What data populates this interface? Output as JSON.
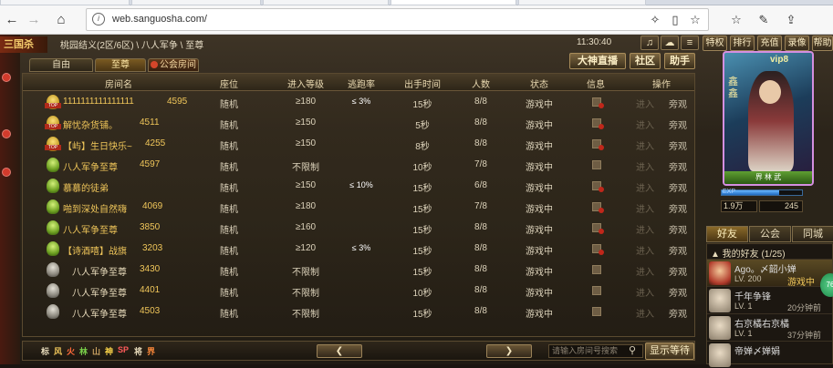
{
  "browser": {
    "url": "web.sanguosha.com/",
    "back_icon": "←",
    "forward_icon": "→",
    "refresh_icon": "⟳",
    "home_icon": "⌂",
    "info_icon": "i",
    "extension_icon": "✧",
    "reading_icon": "▯",
    "favorite_icon": "☆",
    "favorites_list_icon": "☆",
    "notes_icon": "✎",
    "share_icon": "⇪"
  },
  "game": {
    "logo": "三国杀",
    "breadcrumb": "桃园结义(2区/6区) \\ 八人军争 \\ 至尊",
    "clock": "11:30:40",
    "top_icons": [
      "♫",
      "☁",
      "≡"
    ],
    "top_buttons": [
      "特权",
      "排行",
      "充值",
      "录像",
      "帮助"
    ],
    "room_tabs": [
      "自由",
      "至尊",
      "公会房间"
    ],
    "right_buttons": [
      "大神直播",
      "社区",
      "助手"
    ],
    "columns": [
      "房间名",
      "座位",
      "进入等级",
      "逃跑率",
      "出手时间",
      "人数",
      "状态",
      "信息",
      "操作"
    ],
    "rows": [
      {
        "level": "top",
        "name": "1111111111111111",
        "id": "4595",
        "seat": "随机",
        "min_level": "≥180",
        "escape": "≤ 3%",
        "time": "15秒",
        "count": "8/8",
        "status": "游戏中",
        "lock": "red",
        "enter": "进入",
        "watch": "旁观"
      },
      {
        "level": "top",
        "name": "解忧杂货铺。",
        "id": "4511",
        "seat": "随机",
        "min_level": "≥150",
        "escape": "",
        "time": "5秒",
        "count": "8/8",
        "status": "游戏中",
        "lock": "red",
        "enter": "进入",
        "watch": "旁观"
      },
      {
        "level": "top",
        "name": "【屿】生日快乐~",
        "id": "4255",
        "seat": "随机",
        "min_level": "≥150",
        "escape": "",
        "time": "8秒",
        "count": "8/8",
        "status": "游戏中",
        "lock": "red",
        "enter": "进入",
        "watch": "旁观"
      },
      {
        "level": "green",
        "name": "八人军争至尊",
        "id": "4597",
        "seat": "随机",
        "min_level": "不限制",
        "escape": "",
        "time": "10秒",
        "count": "7/8",
        "status": "游戏中",
        "lock": "plain",
        "enter": "进入",
        "watch": "旁观"
      },
      {
        "level": "green",
        "name": "慕慕的徒弟",
        "id": "",
        "seat": "随机",
        "min_level": "≥150",
        "escape": "≤ 10%",
        "time": "15秒",
        "count": "6/8",
        "status": "游戏中",
        "lock": "red",
        "enter": "进入",
        "watch": "旁观"
      },
      {
        "level": "green",
        "name": "啪到深处自然嗨",
        "id": "4069",
        "seat": "随机",
        "min_level": "≥180",
        "escape": "",
        "time": "15秒",
        "count": "7/8",
        "status": "游戏中",
        "lock": "red",
        "enter": "进入",
        "watch": "旁观"
      },
      {
        "level": "green",
        "name": "八人军争至尊",
        "id": "3850",
        "seat": "随机",
        "min_level": "≥160",
        "escape": "",
        "time": "15秒",
        "count": "8/8",
        "status": "游戏中",
        "lock": "red",
        "enter": "进入",
        "watch": "旁观"
      },
      {
        "level": "green",
        "name": "【诗酒嘻】战旗",
        "id": "3203",
        "seat": "随机",
        "min_level": "≥120",
        "escape": "≤ 3%",
        "time": "15秒",
        "count": "8/8",
        "status": "游戏中",
        "lock": "red",
        "enter": "进入",
        "watch": "旁观"
      },
      {
        "level": "grey",
        "name": "八人军争至尊",
        "id": "3430",
        "seat": "随机",
        "min_level": "不限制",
        "escape": "",
        "time": "15秒",
        "count": "8/8",
        "status": "游戏中",
        "lock": "plain",
        "enter": "进入",
        "watch": "旁观"
      },
      {
        "level": "grey",
        "name": "八人军争至尊",
        "id": "4401",
        "seat": "随机",
        "min_level": "不限制",
        "escape": "",
        "time": "10秒",
        "count": "8/8",
        "status": "游戏中",
        "lock": "plain",
        "enter": "进入",
        "watch": "旁观"
      },
      {
        "level": "grey",
        "name": "八人军争至尊",
        "id": "4503",
        "seat": "随机",
        "min_level": "不限制",
        "escape": "",
        "time": "15秒",
        "count": "8/8",
        "status": "游戏中",
        "lock": "plain",
        "enter": "进入",
        "watch": "旁观"
      }
    ],
    "filters": [
      {
        "label": "标",
        "color": "#e8dcbc"
      },
      {
        "label": "风",
        "color": "#f0c65a"
      },
      {
        "label": "火",
        "color": "#ff6a3a"
      },
      {
        "label": "林",
        "color": "#7ad04a"
      },
      {
        "label": "山",
        "color": "#c8a060"
      },
      {
        "label": "神",
        "color": "#ffd84a"
      },
      {
        "label": "SP",
        "color": "#ff5a5a"
      },
      {
        "label": "将",
        "color": "#e8dcbc"
      },
      {
        "label": "界",
        "color": "#ff8a3a"
      }
    ],
    "prev_icon": "❮",
    "next_icon": "❯",
    "search_placeholder": "请输入房间号搜索",
    "search_icon": "⚲",
    "wait_button": "显示等待",
    "profile": {
      "vip": "vip8",
      "vertical_name": "鑫鑫",
      "card_bottom": "界 林 武",
      "exp_label": "EXP",
      "exp_percent": 72,
      "money1": "1.9万",
      "money2": "245"
    },
    "friend_tabs": [
      "好友",
      "公会",
      "同城"
    ],
    "friend_header": "▲ 我的好友 (1/25)",
    "friends": [
      {
        "name": "Ago。〆韶小婵",
        "level": "LV. 200",
        "status": "游戏中",
        "online": true
      },
      {
        "name": "千年争锋",
        "level": "LV. 1",
        "status": "20分钟前",
        "online": false
      },
      {
        "name": "右京橘右京橘",
        "level": "LV. 1",
        "status": "37分钟前",
        "online": false
      },
      {
        "name": "帝婵〆婵娟",
        "level": "",
        "status": "",
        "online": false
      }
    ],
    "float_badge": "76"
  }
}
